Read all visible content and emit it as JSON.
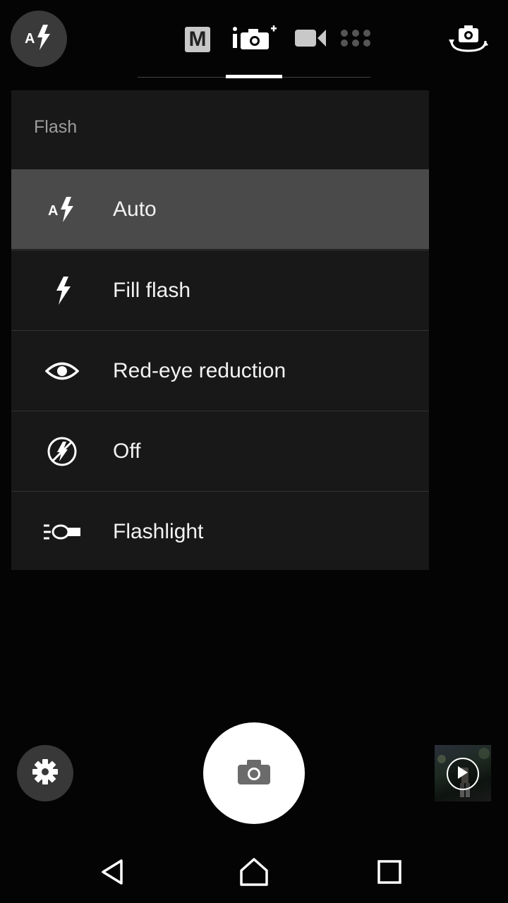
{
  "top_bar": {
    "flash_button_icon": "flash-auto-icon",
    "modes": [
      {
        "name": "manual",
        "label": "M",
        "icon": "manual-mode-icon"
      },
      {
        "name": "superior-auto",
        "icon": "camera-plus-icon",
        "active": true
      },
      {
        "name": "video",
        "icon": "video-camera-icon"
      },
      {
        "name": "camera-apps",
        "icon": "apps-grid-icon"
      }
    ],
    "switch_camera_icon": "switch-camera-icon"
  },
  "flash_menu": {
    "title": "Flash",
    "items": [
      {
        "label": "Auto",
        "icon": "flash-auto-icon",
        "selected": true
      },
      {
        "label": "Fill flash",
        "icon": "flash-on-icon",
        "selected": false
      },
      {
        "label": "Red-eye reduction",
        "icon": "eye-icon",
        "selected": false
      },
      {
        "label": "Off",
        "icon": "flash-off-icon",
        "selected": false
      },
      {
        "label": "Flashlight",
        "icon": "flashlight-icon",
        "selected": false
      }
    ]
  },
  "bottom_bar": {
    "settings_icon": "gear-icon",
    "shutter_icon": "camera-icon",
    "thumbnail_icon": "play-icon"
  },
  "nav": {
    "back_icon": "back-triangle-icon",
    "home_icon": "home-icon",
    "recents_icon": "recents-square-icon"
  },
  "colors": {
    "background": "#050404",
    "menu_bg": "#181818",
    "selected_bg": "#4a4a4a",
    "title_text": "#9e9e9e"
  }
}
